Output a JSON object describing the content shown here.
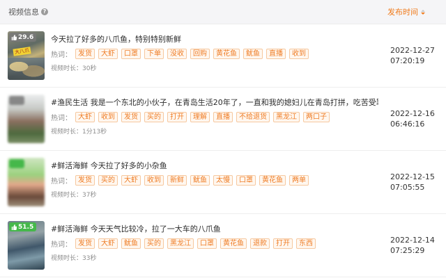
{
  "header": {
    "video_info_label": "视频信息",
    "help_glyph": "?",
    "publish_time_label": "发布时间"
  },
  "rows": [
    {
      "likes": "29.6",
      "thumb_text": "大八爪",
      "title": "今天拉了好多的八爪鱼，特别特别新鲜",
      "hot_label": "热词：",
      "tags": [
        "发货",
        "大虾",
        "口罩",
        "下单",
        "没收",
        "回购",
        "黄花鱼",
        "鱿鱼",
        "直播",
        "收到"
      ],
      "duration": "视频时长：30秒",
      "date": "2022-12-27",
      "time": "07:20:19"
    },
    {
      "likes": "",
      "title": "#渔民生活 我是一个东北的小伙子，在青岛生活20年了，一直和我的媳妇儿在青岛打拼，吃苦受罪...",
      "hot_label": "热词：",
      "tags": [
        "大虾",
        "收到",
        "发货",
        "买的",
        "打开",
        "理解",
        "直播",
        "不给退货",
        "黑龙江",
        "两口子"
      ],
      "duration": "视频时长：1分13秒",
      "date": "2022-12-16",
      "time": "06:46:16"
    },
    {
      "likes": "",
      "title": "#鲜活海鲜 今天拉了好多的小杂鱼",
      "hot_label": "热词：",
      "tags": [
        "发货",
        "买的",
        "大虾",
        "收到",
        "新鲜",
        "鱿鱼",
        "太慢",
        "口罩",
        "黄花鱼",
        "两单"
      ],
      "duration": "视频时长：37秒",
      "date": "2022-12-15",
      "time": "07:05:55"
    },
    {
      "likes": "51.5",
      "title": "#鲜活海鲜 今天天气比较冷，拉了一大车的八爪鱼",
      "hot_label": "热词：",
      "tags": [
        "发货",
        "大虾",
        "鱿鱼",
        "买的",
        "黑龙江",
        "口罩",
        "黄花鱼",
        "退款",
        "打开",
        "东西"
      ],
      "duration": "视频时长：33秒",
      "date": "2022-12-14",
      "time": "07:25:29"
    }
  ],
  "colors": {
    "accent": "#f07a1a",
    "tag_border": "#f6c89f",
    "tag_bg": "#fff7ef",
    "badge_green": "#45b84a"
  }
}
